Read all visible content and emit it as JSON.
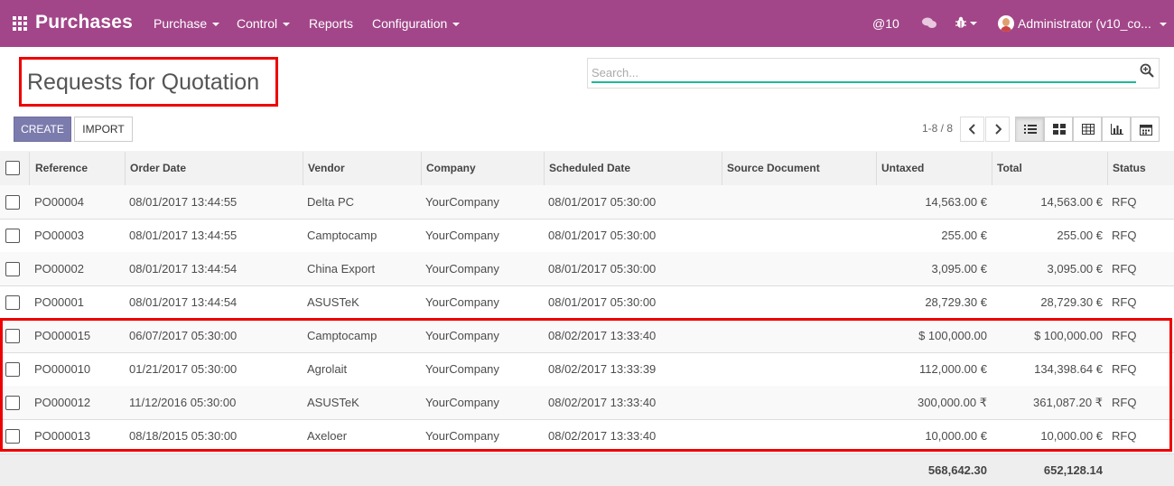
{
  "navbar": {
    "app_name": "Purchases",
    "menu": [
      {
        "label": "Purchase",
        "dropdown": true
      },
      {
        "label": "Control",
        "dropdown": true
      },
      {
        "label": "Reports",
        "dropdown": false
      },
      {
        "label": "Configuration",
        "dropdown": true
      }
    ],
    "mentions": "@10",
    "user": "Administrator (v10_co...",
    "colors": {
      "bar": "#a24689"
    }
  },
  "page": {
    "title": "Requests for Quotation"
  },
  "search": {
    "placeholder": "Search..."
  },
  "buttons": {
    "create": "CREATE",
    "import": "IMPORT"
  },
  "pager": {
    "value": "1-8 / 8",
    "prev_icon": "chevron-left-icon",
    "next_icon": "chevron-right-icon"
  },
  "views": {
    "active": "list",
    "items": [
      "list-view-icon",
      "kanban-view-icon",
      "pivot-view-icon",
      "graph-view-icon",
      "calendar-view-icon"
    ]
  },
  "table": {
    "columns": [
      "Reference",
      "Order Date",
      "Vendor",
      "Company",
      "Scheduled Date",
      "Source Document",
      "Untaxed",
      "Total",
      "Status"
    ],
    "rows": [
      {
        "reference": "PO00004",
        "order_date": "08/01/2017 13:44:55",
        "vendor": "Delta PC",
        "company": "YourCompany",
        "scheduled_date": "08/01/2017 05:30:00",
        "source": "",
        "untaxed": "14,563.00 €",
        "total": "14,563.00 €",
        "status": "RFQ"
      },
      {
        "reference": "PO00003",
        "order_date": "08/01/2017 13:44:55",
        "vendor": "Camptocamp",
        "company": "YourCompany",
        "scheduled_date": "08/01/2017 05:30:00",
        "source": "",
        "untaxed": "255.00 €",
        "total": "255.00 €",
        "status": "RFQ"
      },
      {
        "reference": "PO00002",
        "order_date": "08/01/2017 13:44:54",
        "vendor": "China Export",
        "company": "YourCompany",
        "scheduled_date": "08/01/2017 05:30:00",
        "source": "",
        "untaxed": "3,095.00 €",
        "total": "3,095.00 €",
        "status": "RFQ"
      },
      {
        "reference": "PO00001",
        "order_date": "08/01/2017 13:44:54",
        "vendor": "ASUSTeK",
        "company": "YourCompany",
        "scheduled_date": "08/01/2017 05:30:00",
        "source": "",
        "untaxed": "28,729.30 €",
        "total": "28,729.30 €",
        "status": "RFQ"
      },
      {
        "reference": "PO000015",
        "order_date": "06/07/2017 05:30:00",
        "vendor": "Camptocamp",
        "company": "YourCompany",
        "scheduled_date": "08/02/2017 13:33:40",
        "source": "",
        "untaxed": "$ 100,000.00",
        "total": "$ 100,000.00",
        "status": "RFQ"
      },
      {
        "reference": "PO000010",
        "order_date": "01/21/2017 05:30:00",
        "vendor": "Agrolait",
        "company": "YourCompany",
        "scheduled_date": "08/02/2017 13:33:39",
        "source": "",
        "untaxed": "112,000.00 €",
        "total": "134,398.64 €",
        "status": "RFQ"
      },
      {
        "reference": "PO000012",
        "order_date": "11/12/2016 05:30:00",
        "vendor": "ASUSTeK",
        "company": "YourCompany",
        "scheduled_date": "08/02/2017 13:33:40",
        "source": "",
        "untaxed": "300,000.00 ₹",
        "total": "361,087.20 ₹",
        "status": "RFQ"
      },
      {
        "reference": "PO000013",
        "order_date": "08/18/2015 05:30:00",
        "vendor": "Axeloer",
        "company": "YourCompany",
        "scheduled_date": "08/02/2017 13:33:40",
        "source": "",
        "untaxed": "10,000.00 €",
        "total": "10,000.00 €",
        "status": "RFQ"
      }
    ],
    "totals": {
      "untaxed": "568,642.30",
      "total": "652,128.14"
    }
  },
  "annotations": {
    "highlight_color": "#ee0000"
  }
}
